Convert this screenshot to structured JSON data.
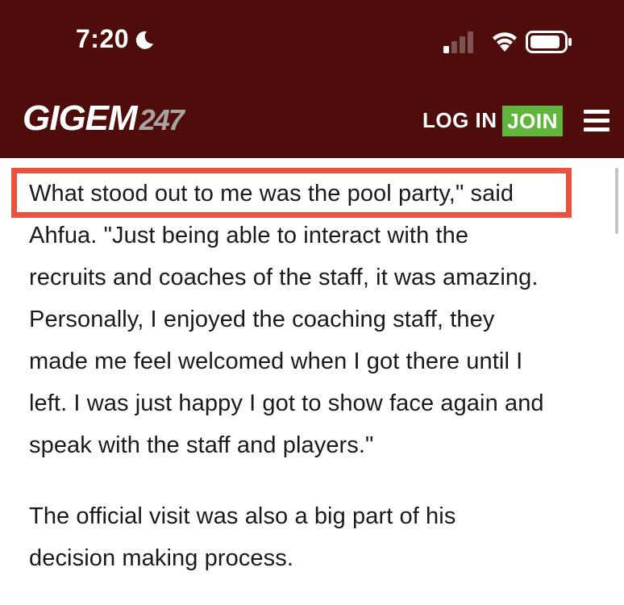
{
  "status_bar": {
    "time": "7:20",
    "focus_icon": "moon-icon",
    "signal_icon": "signal-bars-icon",
    "wifi_icon": "wifi-icon",
    "battery_icon": "battery-icon"
  },
  "header": {
    "logo_main": "GIGEM",
    "logo_number": "247",
    "login_label": "LOG IN",
    "join_label": "JOIN",
    "menu_icon": "hamburger-menu-icon",
    "background_color": "#4e0d0a",
    "join_color": "#60b63c"
  },
  "article": {
    "highlight_color": "#e8523f",
    "lines": [
      "What stood out to me was the pool party,\" said",
      "Ahfua. \"Just being able to interact with the",
      "recruits and coaches of the staff, it was amazing.",
      "Personally, I enjoyed the coaching staff, they",
      "made me feel welcomed when I got there until I",
      "left. I was just happy I got to show face again and",
      "speak with the staff and players.\"",
      "The official visit was also a big part of his",
      "decision making process."
    ]
  }
}
